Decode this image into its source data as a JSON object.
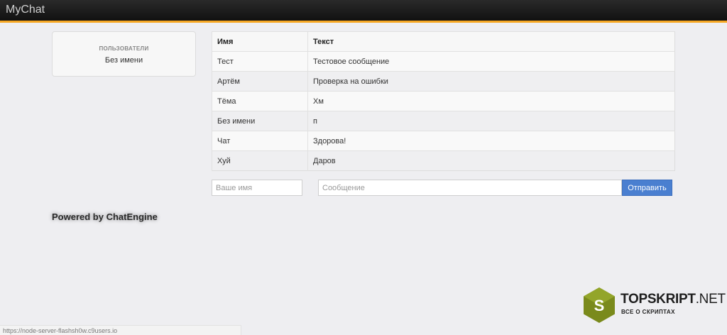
{
  "navbar": {
    "brand": "MyChat"
  },
  "users": {
    "title": "ПОЛЬЗОВАТЕЛИ",
    "list": [
      "Без имени"
    ]
  },
  "table": {
    "headers": [
      "Имя",
      "Текст"
    ],
    "rows": [
      {
        "name": "Тест",
        "text": "Тестовое сообщение"
      },
      {
        "name": "Артём",
        "text": "Проверка на ошибки"
      },
      {
        "name": "Тёма",
        "text": "Хм"
      },
      {
        "name": "Без имени",
        "text": "п"
      },
      {
        "name": "Чат",
        "text": "Здорова!"
      },
      {
        "name": "Хуй",
        "text": "Даров"
      }
    ]
  },
  "form": {
    "name_placeholder": "Ваше имя",
    "name_value": "",
    "message_placeholder": "Сообщение",
    "message_value": "",
    "send_label": "Отправить"
  },
  "footer": {
    "powered": "Powered by ChatEngine"
  },
  "status_url": "https://node-server-flashsh0w.c9users.io",
  "watermark": {
    "title_bold": "TOPSKRIPT",
    "title_rest": ".NET",
    "subtitle": "ВСЕ О СКРИПТАХ",
    "letter": "S"
  },
  "colors": {
    "accent": "#f5a623",
    "button": "#4a7fd0",
    "logo_green": "#7a8a1c"
  }
}
